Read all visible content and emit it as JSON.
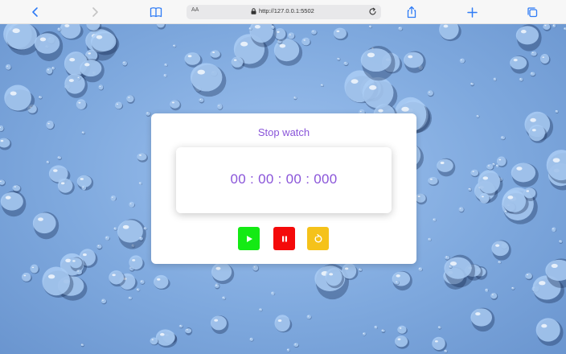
{
  "browser": {
    "address_prefix": "AA",
    "url": "http://127.0.0.1:5502"
  },
  "app": {
    "title": "Stop watch",
    "time_display": "00 : 00 : 00 : 000",
    "controls": [
      {
        "name": "play",
        "icon": "play-icon",
        "color": "#14ea14"
      },
      {
        "name": "pause",
        "icon": "pause-icon",
        "color": "#f40a0a"
      },
      {
        "name": "reset",
        "icon": "reset-icon",
        "color": "#f5c21a"
      }
    ]
  },
  "colors": {
    "accent": "#8a55d9",
    "browser_icon": "#2f7cf6",
    "background_blue": "#7fa9de"
  }
}
